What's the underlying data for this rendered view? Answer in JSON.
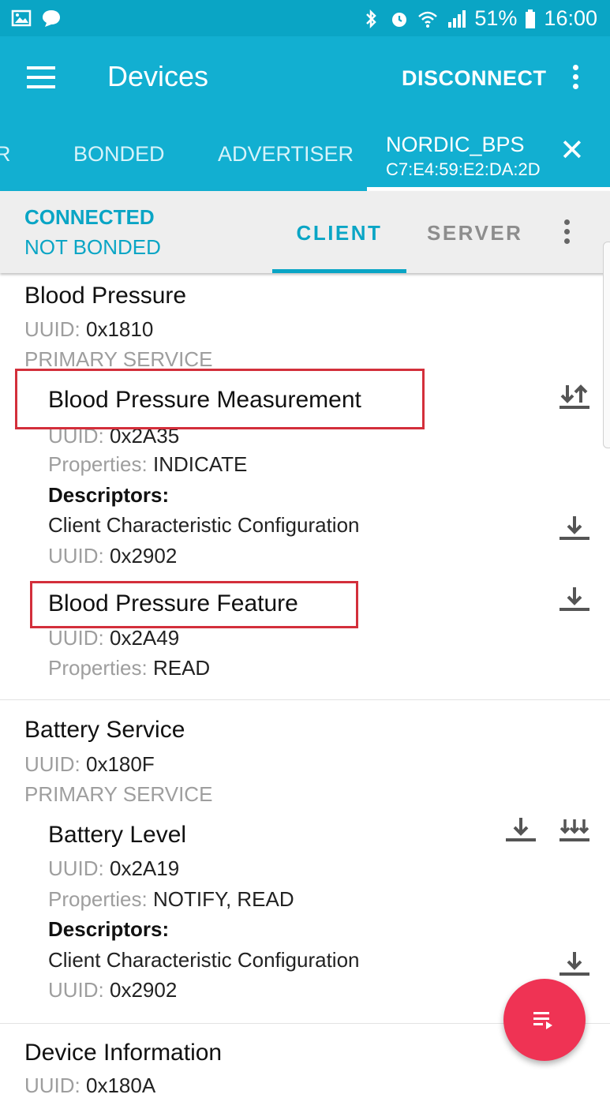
{
  "status_bar": {
    "battery": "51%",
    "time": "16:00",
    "left_icons": [
      "image-icon",
      "chat-bubble-icon"
    ],
    "right_icons": [
      "bluetooth-icon",
      "alarm-icon",
      "wifi-icon",
      "signal-icon",
      "battery-icon"
    ]
  },
  "app_bar": {
    "title": "Devices",
    "action": "DISCONNECT"
  },
  "device_tabs": {
    "items": [
      "R",
      "BONDED",
      "ADVERTISER"
    ],
    "active": {
      "name": "NORDIC_BPS",
      "address": "C7:E4:59:E2:DA:2D"
    }
  },
  "connection": {
    "state": "CONNECTED",
    "bond": "NOT BONDED",
    "tabs": [
      "CLIENT",
      "SERVER"
    ],
    "active_tab": "CLIENT"
  },
  "labels": {
    "uuid": "UUID:",
    "properties": "Properties:",
    "descriptors": "Descriptors:"
  },
  "services": [
    {
      "name": "Blood Pressure",
      "uuid": "0x1810",
      "type": "PRIMARY SERVICE",
      "characteristics": [
        {
          "name": "Blood Pressure Measurement",
          "uuid": "0x2A35",
          "properties": "INDICATE",
          "highlighted": true,
          "actions": [
            "indicate-toggle-icon"
          ],
          "descriptors": [
            {
              "name": "Client Characteristic Configuration",
              "uuid": "0x2902"
            }
          ]
        },
        {
          "name": "Blood Pressure Feature",
          "uuid": "0x2A49",
          "properties": "READ",
          "highlighted": true,
          "actions": [
            "read-icon"
          ]
        }
      ]
    },
    {
      "name": "Battery Service",
      "uuid": "0x180F",
      "type": "PRIMARY SERVICE",
      "characteristics": [
        {
          "name": "Battery Level",
          "uuid": "0x2A19",
          "properties": "NOTIFY, READ",
          "actions": [
            "read-icon",
            "notify-icon"
          ],
          "descriptors": [
            {
              "name": "Client Characteristic Configuration",
              "uuid": "0x2902"
            }
          ]
        }
      ]
    },
    {
      "name": "Device Information",
      "uuid": "0x180A"
    }
  ],
  "fab": {
    "icon": "playlist-icon"
  },
  "colors": {
    "status_bar": "#0aa5c5",
    "app_bar": "#12afd1",
    "accent": "#0aa5c5",
    "highlight_box": "#d32f3b",
    "fab": "#ef3354"
  }
}
